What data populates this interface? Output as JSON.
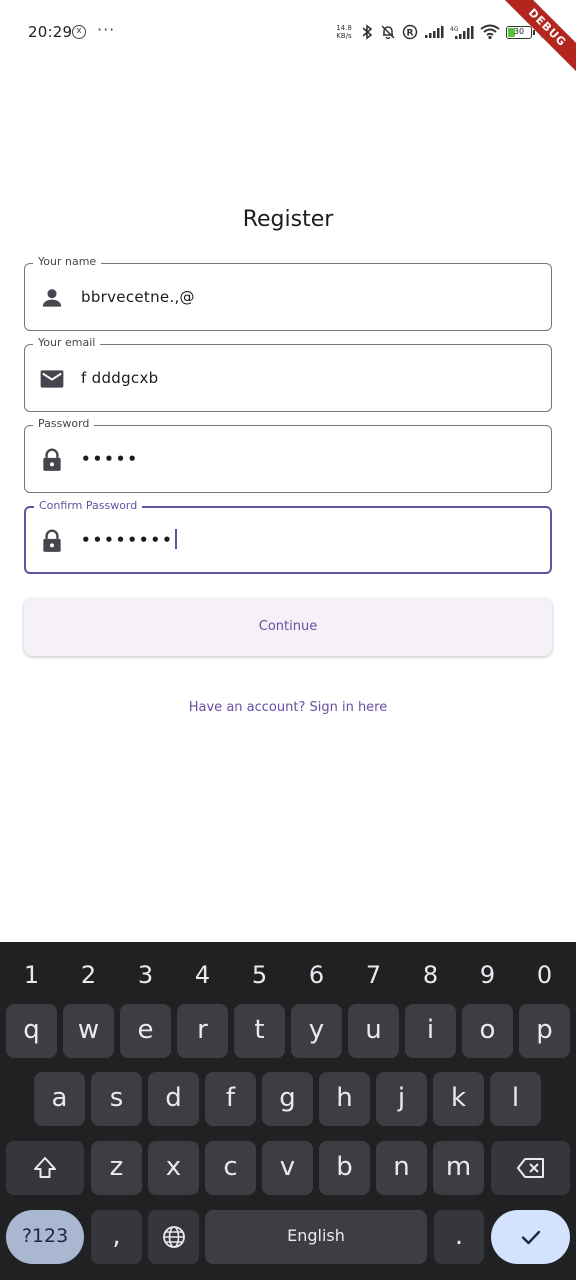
{
  "status_bar": {
    "time": "20:29",
    "notif_icon_text": "x",
    "more_dots": "···",
    "net_speed": "14.8\nKB/s",
    "battery_level": "30",
    "debug_banner": "DEBUG"
  },
  "form": {
    "title": "Register",
    "name": {
      "label": "Your name",
      "value": "bbrvecetne.,@",
      "icon": "person-icon"
    },
    "email": {
      "label": "Your email",
      "value": "f dddgcxb",
      "icon": "mail-icon"
    },
    "password": {
      "label": "Password",
      "value": "•••••",
      "icon": "lock-icon"
    },
    "confirm_password": {
      "label": "Confirm Password",
      "value": "••••••••",
      "icon": "lock-icon",
      "focused": true
    },
    "continue_label": "Continue",
    "signin_link": "Have an account? Sign in here"
  },
  "colors": {
    "primary": "#6750a4",
    "outline": "#79747e",
    "button_bg": "#f6f1f8",
    "keyboard_bg": "#1f2123",
    "key_bg": "#3c3e41",
    "enter_key_bg": "#d3e3fd",
    "sym_key_bg": "#a9b7d1"
  },
  "keyboard": {
    "numbers": [
      "1",
      "2",
      "3",
      "4",
      "5",
      "6",
      "7",
      "8",
      "9",
      "0"
    ],
    "row1": [
      "q",
      "w",
      "e",
      "r",
      "t",
      "y",
      "u",
      "i",
      "o",
      "p"
    ],
    "row2": [
      "a",
      "s",
      "d",
      "f",
      "g",
      "h",
      "j",
      "k",
      "l"
    ],
    "row3": [
      "z",
      "x",
      "c",
      "v",
      "b",
      "n",
      "m"
    ],
    "sym_label": "?123",
    "comma": ",",
    "space_label": "English",
    "period": "."
  }
}
